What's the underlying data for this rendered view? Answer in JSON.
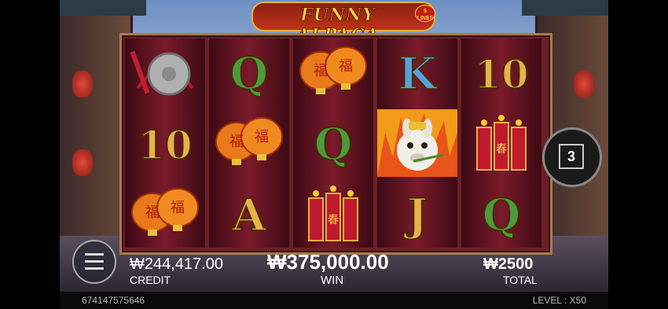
{
  "title": "FUNNY ALPACA",
  "lines_badge": "5 LINES",
  "reels": [
    [
      {
        "type": "gong",
        "name": "gong-symbol"
      },
      {
        "type": "text",
        "label": "10",
        "color": "gold"
      },
      {
        "type": "lantern",
        "name": "lanterns-symbol"
      }
    ],
    [
      {
        "type": "text",
        "label": "Q",
        "color": "green"
      },
      {
        "type": "lantern",
        "name": "lanterns-symbol"
      },
      {
        "type": "text",
        "label": "A",
        "color": "gold"
      }
    ],
    [
      {
        "type": "lantern",
        "name": "lanterns-symbol"
      },
      {
        "type": "text",
        "label": "Q",
        "color": "green"
      },
      {
        "type": "firecracker",
        "name": "firecracker-symbol"
      }
    ],
    [
      {
        "type": "text",
        "label": "K",
        "color": "blue"
      },
      {
        "type": "alpaca",
        "name": "alpaca-wild-symbol"
      },
      {
        "type": "text",
        "label": "J",
        "color": "gold"
      }
    ],
    [
      {
        "type": "text",
        "label": "10",
        "color": "gold"
      },
      {
        "type": "firecracker",
        "name": "firecracker-symbol"
      },
      {
        "type": "text",
        "label": "Q",
        "color": "green"
      }
    ]
  ],
  "counter": "3",
  "credit": {
    "value": "₩244,417.00",
    "label": "CREDIT"
  },
  "win": {
    "value": "₩375,000.00",
    "label": "WIN"
  },
  "bet": {
    "value": "₩2500",
    "label": "TOTAL"
  },
  "footer": {
    "game_id": "674147575646",
    "level": "LEVEL : X50"
  }
}
